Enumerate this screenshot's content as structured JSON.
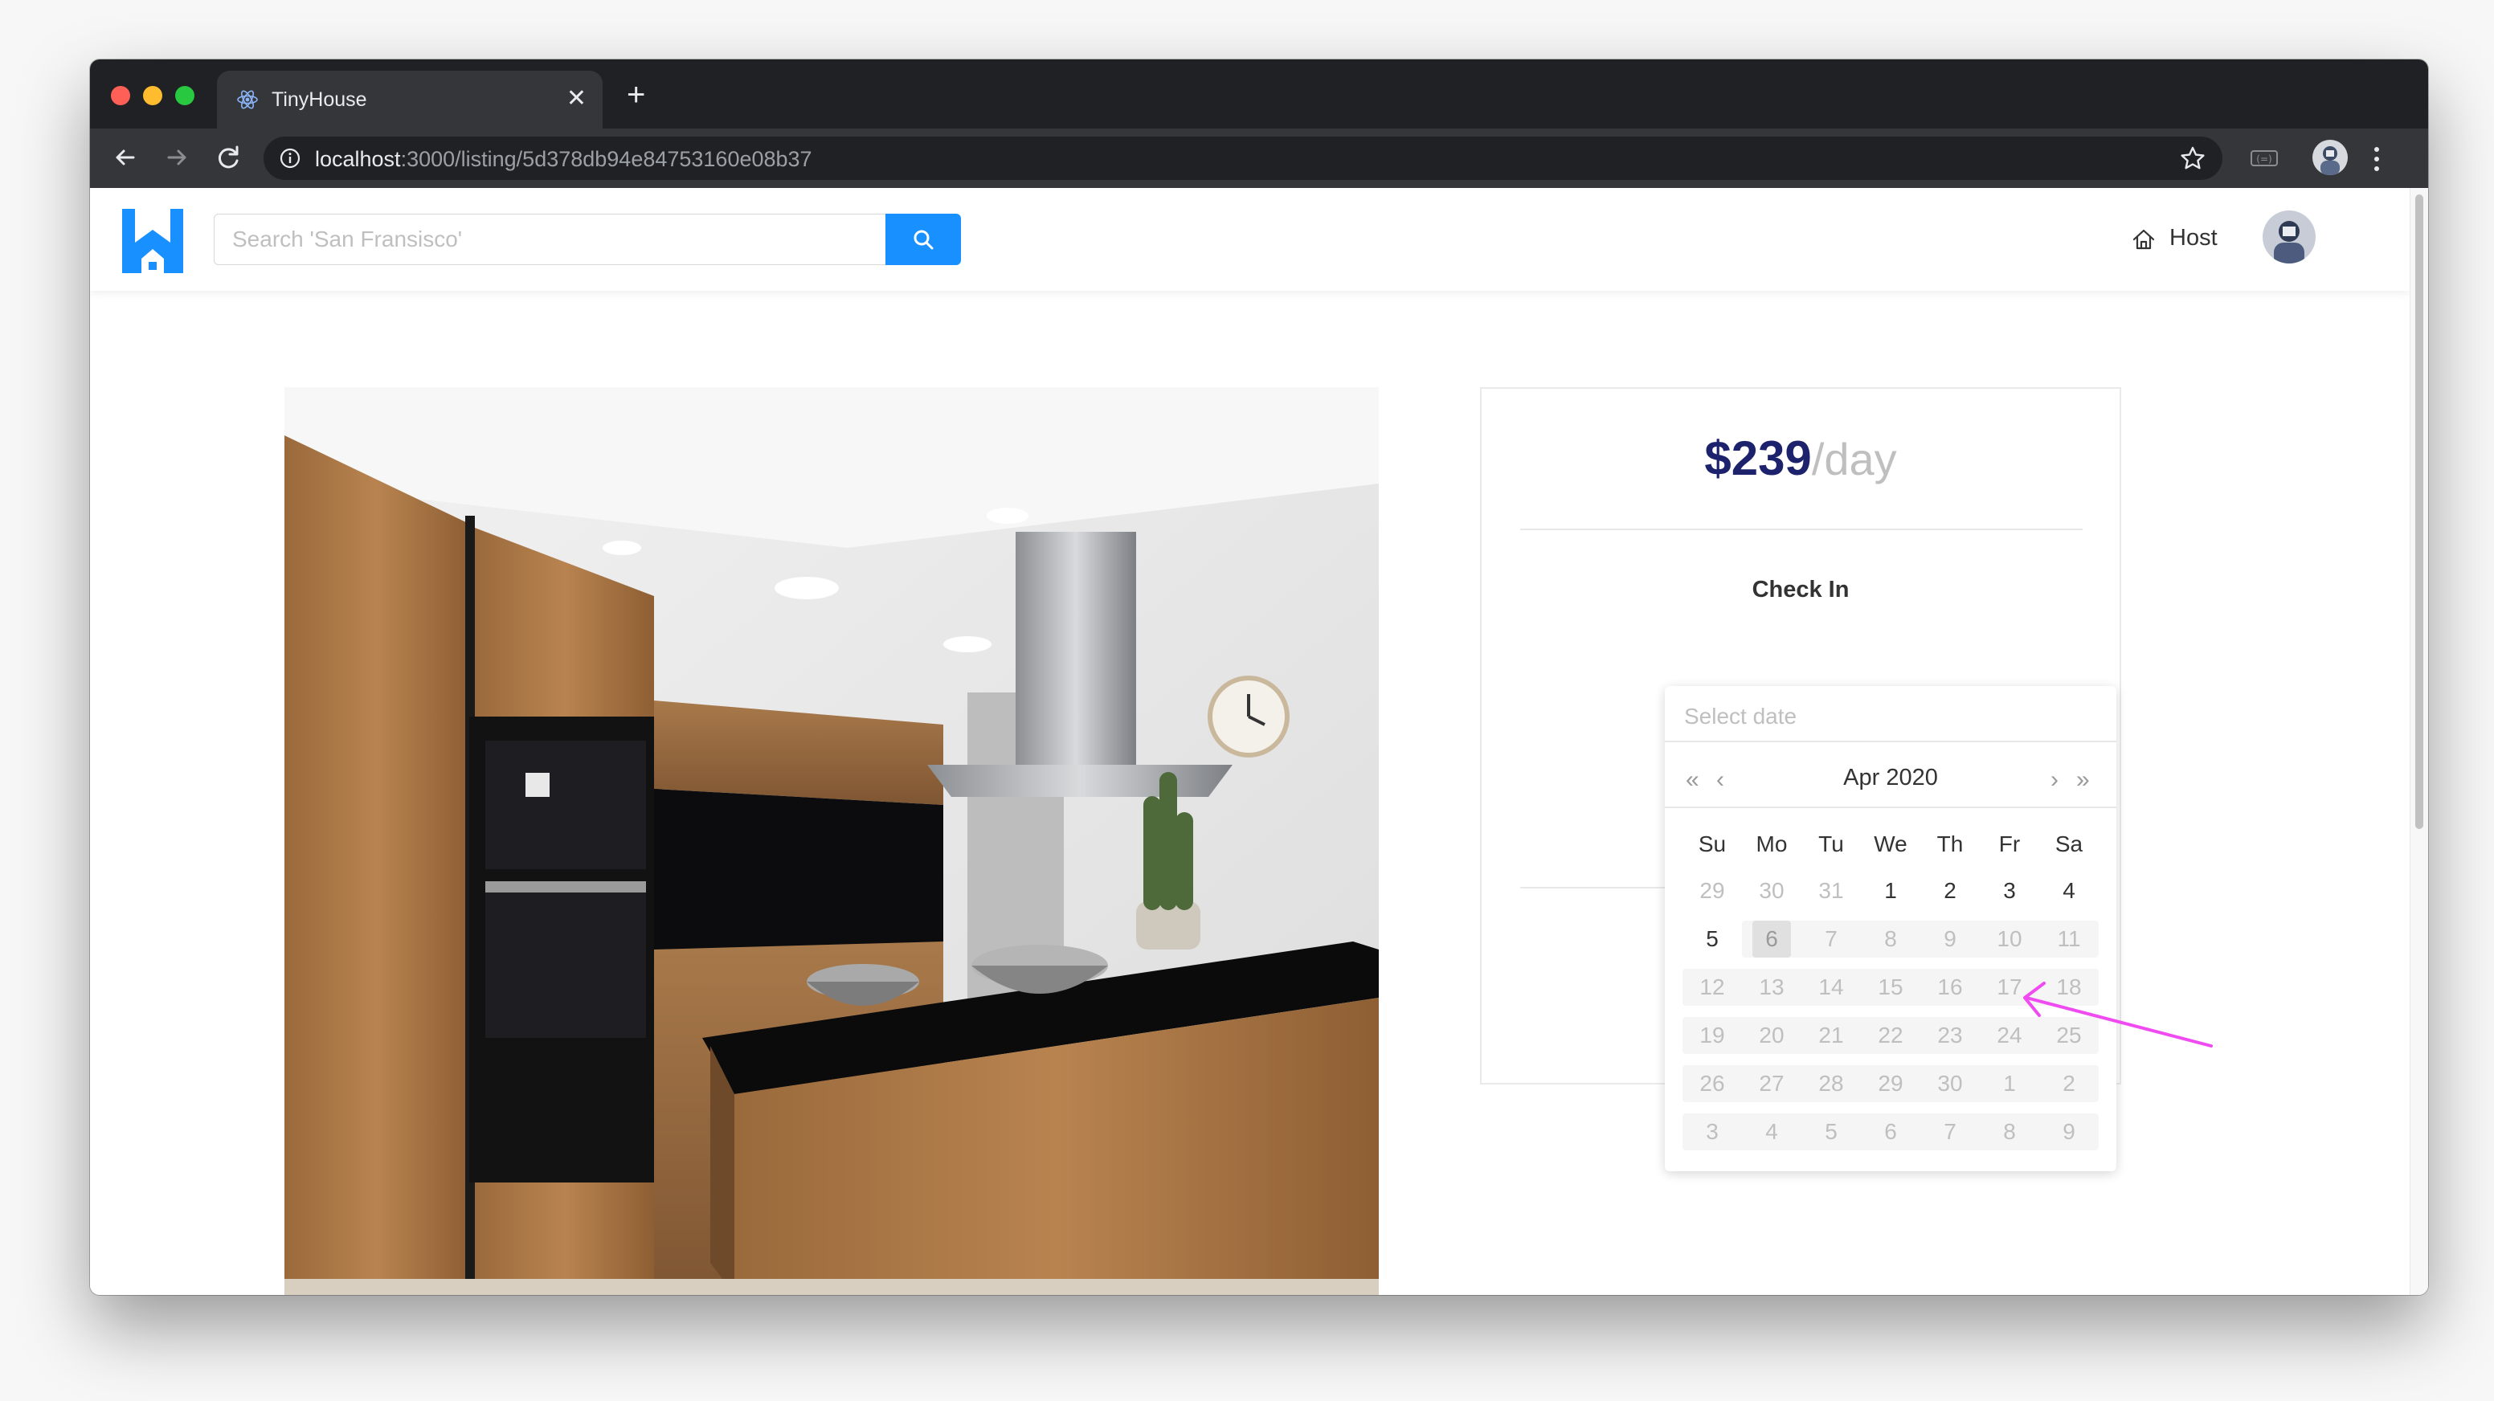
{
  "browser": {
    "tab_title": "TinyHouse",
    "url_host": "localhost",
    "url_rest": ":3000/listing/5d378db94e84753160e08b37"
  },
  "header": {
    "search_placeholder": "Search 'San Fransisco'",
    "host_label": "Host"
  },
  "booking": {
    "price_amount": "$239",
    "price_unit": "/day",
    "checkin_label": "Check In"
  },
  "datepicker": {
    "placeholder": "Select date",
    "month_label": "Apr 2020",
    "weekdays": [
      "Su",
      "Mo",
      "Tu",
      "We",
      "Th",
      "Fr",
      "Sa"
    ],
    "today": "6",
    "weeks": [
      [
        "29",
        "30",
        "31",
        "1",
        "2",
        "3",
        "4"
      ],
      [
        "5",
        "6",
        "7",
        "8",
        "9",
        "10",
        "11"
      ],
      [
        "12",
        "13",
        "14",
        "15",
        "16",
        "17",
        "18"
      ],
      [
        "19",
        "20",
        "21",
        "22",
        "23",
        "24",
        "25"
      ],
      [
        "26",
        "27",
        "28",
        "29",
        "30",
        "1",
        "2"
      ],
      [
        "3",
        "4",
        "5",
        "6",
        "7",
        "8",
        "9"
      ]
    ]
  },
  "colors": {
    "accent_blue": "#1890ff",
    "price_navy": "#1d226c",
    "annotation_arrow": "#f04bf0"
  }
}
